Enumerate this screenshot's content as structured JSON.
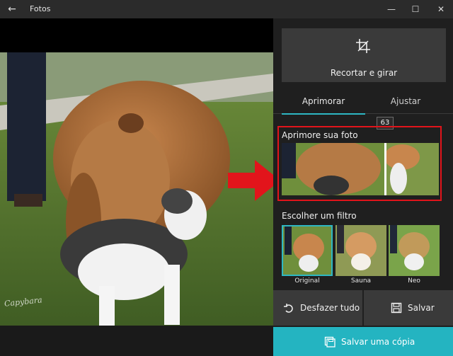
{
  "window": {
    "title": "Fotos"
  },
  "photo": {
    "watermark": "Capybara"
  },
  "panel": {
    "crop_button_label": "Recortar e girar",
    "tabs": [
      {
        "label": "Aprimorar",
        "active": true
      },
      {
        "label": "Ajustar",
        "active": false
      }
    ],
    "enhance": {
      "title": "Aprimore sua foto",
      "value": "63"
    },
    "filters": {
      "title": "Escolher um filtro",
      "items": [
        {
          "label": "Original",
          "selected": true
        },
        {
          "label": "Sauna",
          "selected": false
        },
        {
          "label": "Neo",
          "selected": false
        }
      ]
    },
    "undo_label": "Desfazer tudo",
    "save_label": "Salvar",
    "save_copy_label": "Salvar uma cópia"
  },
  "colors": {
    "accent": "#24b4c1",
    "highlight": "#e2141b"
  }
}
